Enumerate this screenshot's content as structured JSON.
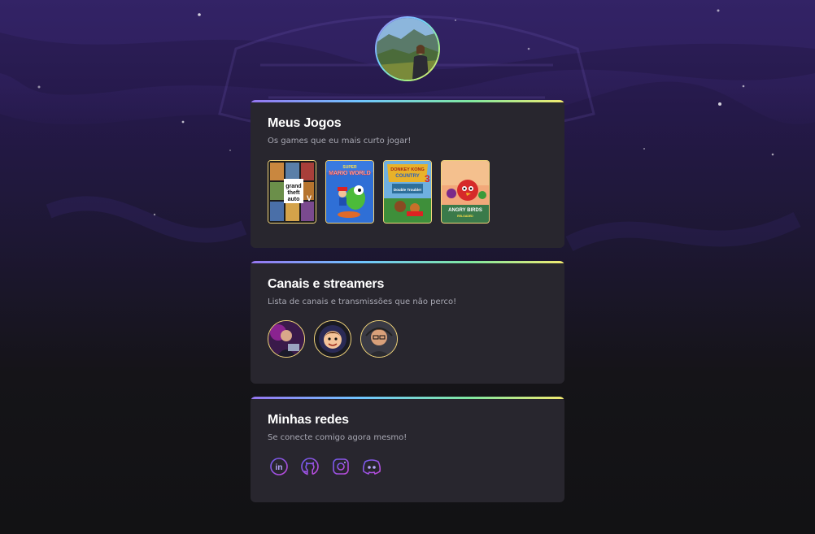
{
  "profile": {
    "avatar_alt": "Foto de perfil"
  },
  "games_card": {
    "title": "Meus Jogos",
    "subtitle": "Os games que eu mais curto jogar!",
    "games": [
      {
        "name": "GTA V",
        "icon": "gta-v-cover"
      },
      {
        "name": "Super Mario World",
        "icon": "super-mario-world-cover"
      },
      {
        "name": "Donkey Kong Country 3",
        "icon": "donkey-kong-country-3-cover"
      },
      {
        "name": "Angry Birds Reloaded",
        "icon": "angry-birds-reloaded-cover"
      }
    ]
  },
  "streamers_card": {
    "title": "Canais e streamers",
    "subtitle": "Lista de canais e transmissões que não perco!",
    "streamers": [
      {
        "icon": "streamer-1-avatar"
      },
      {
        "icon": "streamer-2-avatar"
      },
      {
        "icon": "streamer-3-avatar"
      }
    ]
  },
  "socials_card": {
    "title": "Minhas redes",
    "subtitle": "Se conecte comigo agora mesmo!",
    "links": [
      {
        "icon": "linkedin-icon"
      },
      {
        "icon": "github-icon"
      },
      {
        "icon": "instagram-icon"
      },
      {
        "icon": "discord-icon"
      }
    ]
  },
  "colors": {
    "card_bg": "#28262e",
    "accent_border": "#f1d47a",
    "title": "#ffffff",
    "subtitle": "#a8a8b3",
    "social_icon": "#8a5cf6"
  }
}
